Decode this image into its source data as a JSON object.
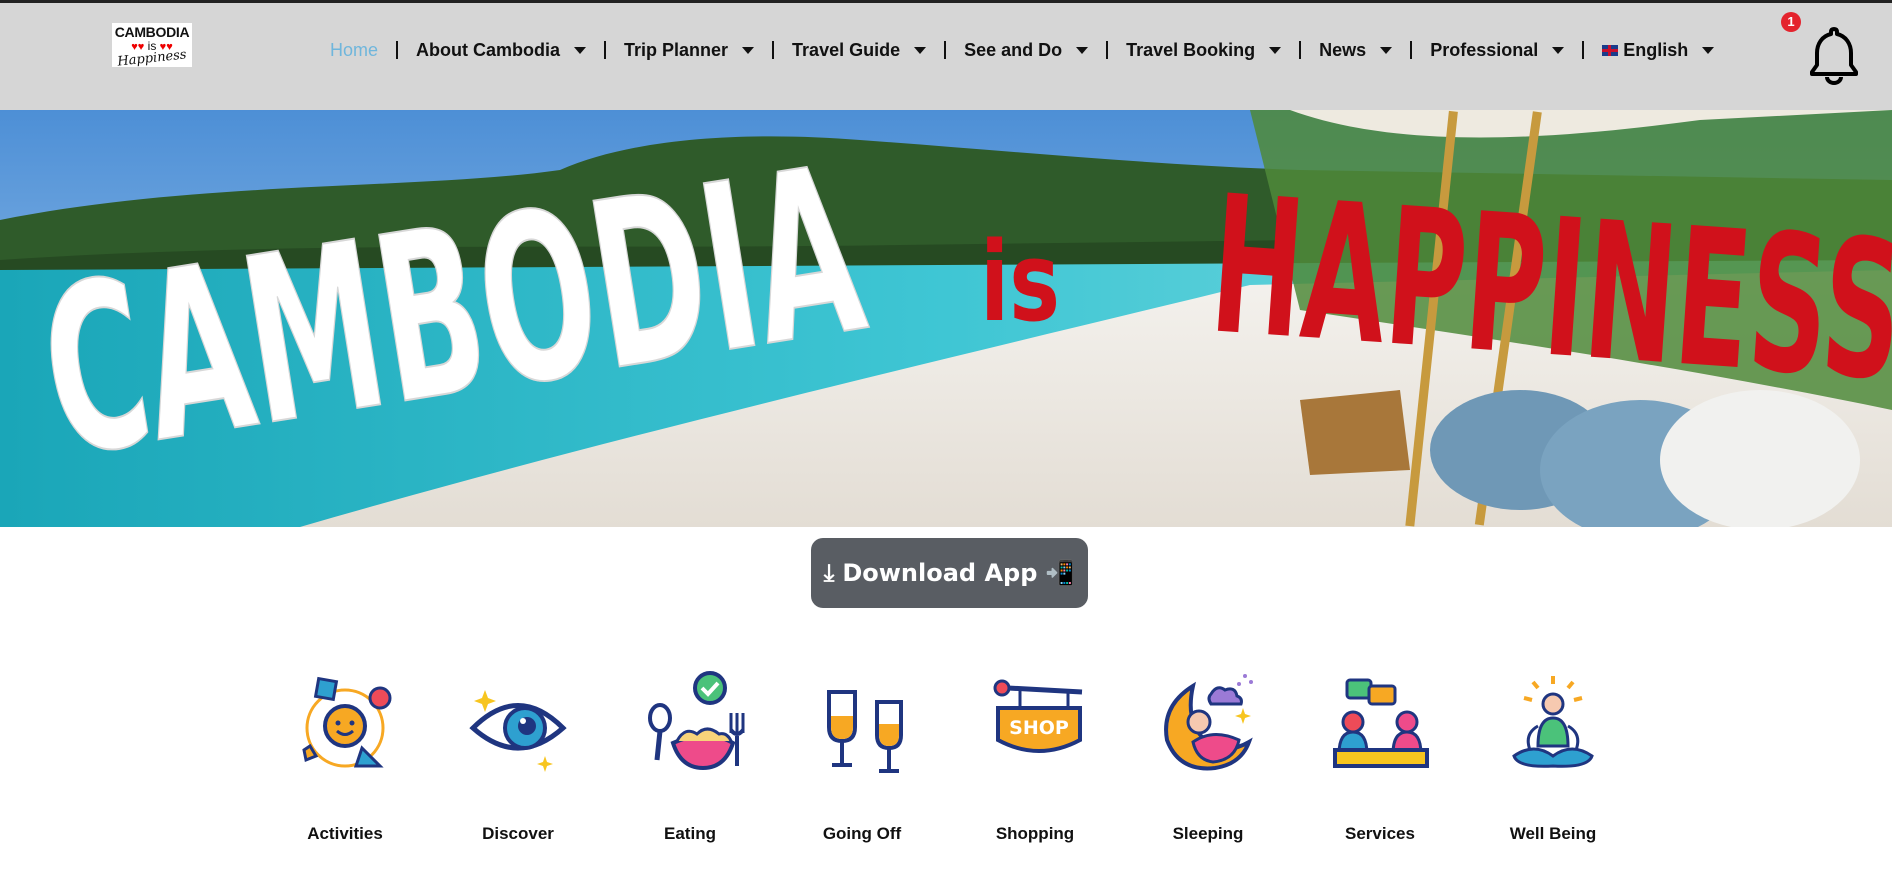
{
  "header": {
    "logo": {
      "line1": "CAMBODIA",
      "line2": "is",
      "line3": "Happiness"
    },
    "nav": [
      {
        "label": "Home",
        "active": true,
        "dropdown": false
      },
      {
        "label": "About Cambodia",
        "active": false,
        "dropdown": true
      },
      {
        "label": "Trip Planner",
        "active": false,
        "dropdown": true
      },
      {
        "label": "Travel Guide",
        "active": false,
        "dropdown": true
      },
      {
        "label": "See and Do",
        "active": false,
        "dropdown": true
      },
      {
        "label": "Travel Booking",
        "active": false,
        "dropdown": true
      },
      {
        "label": "News",
        "active": false,
        "dropdown": true
      },
      {
        "label": "Professional",
        "active": false,
        "dropdown": true
      },
      {
        "label": "English",
        "active": false,
        "dropdown": true,
        "icon": "uk-flag-icon"
      }
    ],
    "notifications": {
      "count": "1",
      "icon": "bell-icon"
    }
  },
  "hero": {
    "word1": "CAMBODIA",
    "word2": "is",
    "word3": "HAPPINESS"
  },
  "download": {
    "label": "Download App",
    "icon": "download-icon",
    "trailing_icon": "mobile-phone-icon"
  },
  "categories": [
    {
      "label": "Activities",
      "icon": "activities-icon"
    },
    {
      "label": "Discover",
      "icon": "eye-icon"
    },
    {
      "label": "Eating",
      "icon": "eating-icon"
    },
    {
      "label": "Going Off",
      "icon": "glasses-icon"
    },
    {
      "label": "Shopping",
      "icon": "shop-sign-icon"
    },
    {
      "label": "Sleeping",
      "icon": "moon-sleep-icon"
    },
    {
      "label": "Services",
      "icon": "services-icon"
    },
    {
      "label": "Well Being",
      "icon": "meditation-icon"
    }
  ],
  "colors": {
    "header_bg": "#d6d6d6",
    "active_nav": "#6fb6dc",
    "badge": "#e4232d",
    "download_bg": "#595d63",
    "hero_red": "#d0111b",
    "icon_navy": "#1f3580",
    "icon_orange": "#f7a823"
  }
}
